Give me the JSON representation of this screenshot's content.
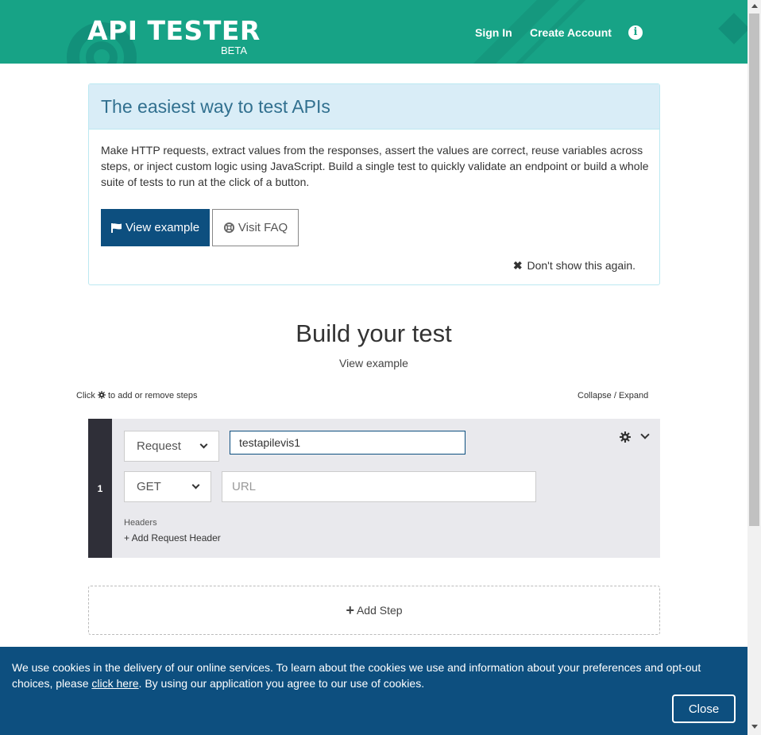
{
  "header": {
    "title": "API TESTER",
    "badge": "BETA",
    "nav": {
      "sign_in": "Sign In",
      "create_account": "Create Account"
    },
    "info_icon_glyph": "i",
    "background_color": "#17a386"
  },
  "intro": {
    "title": "The easiest way to test APIs",
    "description": "Make HTTP requests, extract values from the responses, assert the values are correct, reuse variables across steps, or inject custom logic using JavaScript. Build a single test to quickly validate an endpoint or build a whole suite of tests to run at the click of a button.",
    "view_example_label": "View example",
    "visit_faq_label": "Visit FAQ",
    "dont_show_label": "Don't show this again.",
    "dismiss_glyph": "✖"
  },
  "builder": {
    "title": "Build your test",
    "view_example_link": "View example",
    "hint_prefix": "Click",
    "hint_suffix": "to add or remove steps",
    "collapse_label": "Collapse / Expand"
  },
  "steps": [
    {
      "number": "1",
      "type_value": "Request",
      "name_value": "testapilevis1",
      "method_value": "GET",
      "url_placeholder": "URL",
      "headers_label": "Headers",
      "add_header_label": "+ Add Request Header"
    }
  ],
  "add_step": {
    "plus_glyph": "+",
    "label": "Add Step"
  },
  "cookie_banner": {
    "text_before": "We use cookies in the delivery of our online services. To learn about the cookies we use and information about your preferences and opt-out choices, please ",
    "link_text": "click here",
    "text_after": ". By using our application you agree to our use of cookies.",
    "close_label": "Close",
    "background_color": "#0d4f7f"
  },
  "colors": {
    "primary": "#0d4f7f",
    "accent": "#17a386",
    "step_bar": "#2f2f38"
  }
}
